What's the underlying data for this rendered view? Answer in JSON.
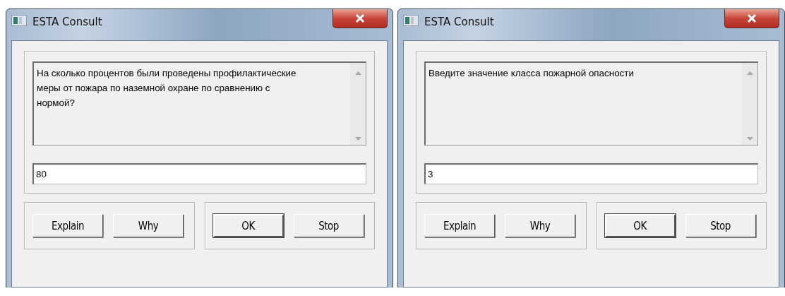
{
  "windows": [
    {
      "title": "ESTA Consult",
      "question": "На сколько процентов были проведены профилактические меры от пожара по наземной охране по сравнению с нормой?",
      "answer": "80",
      "button_groups": [
        [
          {
            "label": "Explain",
            "default": false
          },
          {
            "label": "Why",
            "default": false
          }
        ],
        [
          {
            "label": "OK",
            "default": true
          },
          {
            "label": "Stop",
            "default": false
          }
        ]
      ]
    },
    {
      "title": "ESTA Consult",
      "question": "Введите значение класса пожарной опасности",
      "answer": "3",
      "button_groups": [
        [
          {
            "label": "Explain",
            "default": false
          },
          {
            "label": "Why",
            "default": false
          }
        ],
        [
          {
            "label": "OK",
            "default": true
          },
          {
            "label": "Stop",
            "default": false
          }
        ]
      ]
    }
  ]
}
